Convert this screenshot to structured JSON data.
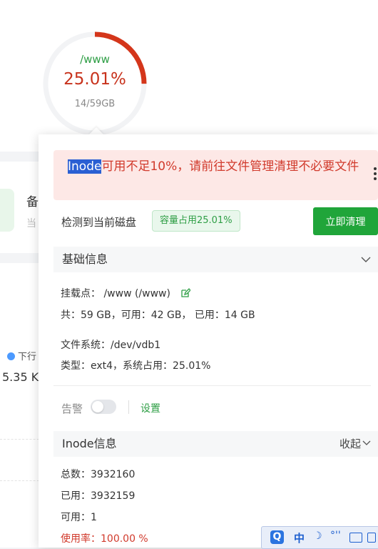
{
  "gauge": {
    "path": "/www",
    "percent": "25.01%",
    "size": "14/59GB",
    "fill_fraction": 0.2501,
    "color_used": "#d4361b",
    "color_track": "#f2f3f5"
  },
  "background": {
    "card_title_partial": "备",
    "card_sub_partial": "当",
    "legend_partial": "下行",
    "speed_partial": "5.35 K"
  },
  "popover": {
    "alert": {
      "highlight": "Inode",
      "text": "可用不足10%，请前往文件管理清理不必要文件",
      "more_icon": "more-vertical-icon"
    },
    "detect_text": "检测到当前磁盘",
    "badge_text": "容量占用25.01%",
    "clean_button": "立即清理",
    "basic_section": {
      "title": "基础信息",
      "chevron": "chevron-down-icon",
      "mount_line": "挂载点：  /www (/www)",
      "capacity_line": "共：59 GB，可用：42 GB，  已用：14 GB",
      "fs_line": "文件系统：/dev/vdb1",
      "type_line": "类型：ext4，系统占用：25.01%"
    },
    "alarm": {
      "label": "告警",
      "toggle_on": false,
      "setting_link": "设置"
    },
    "inode_section": {
      "title": "Inode信息",
      "collapse_label": "收起",
      "total_line": "总数：3932160",
      "used_line": "已用：3932159",
      "free_line": "可用：1",
      "rate_line": "使用率：100.00 %"
    }
  },
  "ime": {
    "logo": "Q",
    "mode": "中",
    "moon": "☽",
    "punct": "°''"
  },
  "colors": {
    "accent_green": "#20a53a",
    "danger_red": "#d13a2c",
    "alert_bg": "#fde8e6"
  }
}
